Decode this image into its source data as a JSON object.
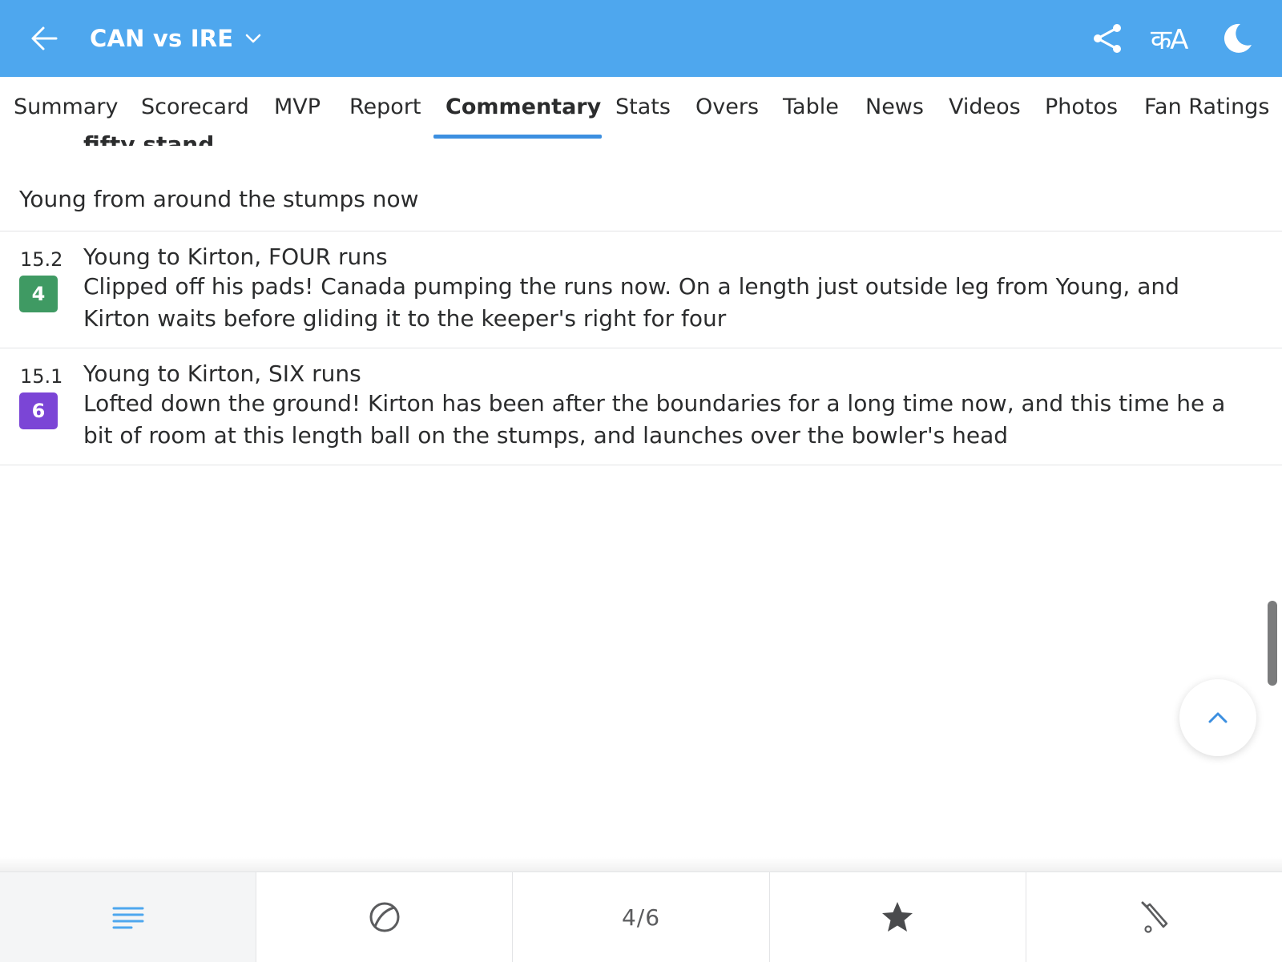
{
  "header": {
    "title": "CAN vs IRE",
    "lang_label": "कA",
    "icons": [
      "back-arrow-icon",
      "chevron-down-icon",
      "share-icon",
      "language-icon",
      "moon-icon"
    ]
  },
  "tabs": [
    {
      "label": "Summary"
    },
    {
      "label": "Scorecard"
    },
    {
      "label": "MVP"
    },
    {
      "label": "Report"
    },
    {
      "label": "Commentary",
      "active": true
    },
    {
      "label": "Stats"
    },
    {
      "label": "Overs"
    },
    {
      "label": "Table"
    },
    {
      "label": "News"
    },
    {
      "label": "Videos"
    },
    {
      "label": "Photos"
    },
    {
      "label": "Fan Ratings"
    }
  ],
  "commentary": {
    "cut_headline": "fifty stand",
    "note": "Young from around the stumps now",
    "balls": [
      {
        "over": "15.2",
        "runs": "4",
        "badge_color": "#3f9a63",
        "title": "Young to Kirton, FOUR runs",
        "text": "Clipped off his pads! Canada pumping the runs now. On a length just outside leg from Young, and Kirton waits before gliding it to the keeper's right for four"
      },
      {
        "over": "15.1",
        "runs": "6",
        "badge_color": "#7b45d6",
        "title": "Young to Kirton, SIX runs",
        "text": "Lofted down the ground! Kirton has been after the boundaries for a long time now, and this time he a bit of room at this length ball on the stumps, and launches over the bowler's head"
      }
    ]
  },
  "bottom_bar": {
    "page_indicator": "4/6",
    "icons": [
      "list-icon",
      "ball-icon",
      "star-icon",
      "bat-icon"
    ]
  },
  "colors": {
    "header_bg": "#4ea7ee",
    "accent": "#3c8fe0"
  }
}
